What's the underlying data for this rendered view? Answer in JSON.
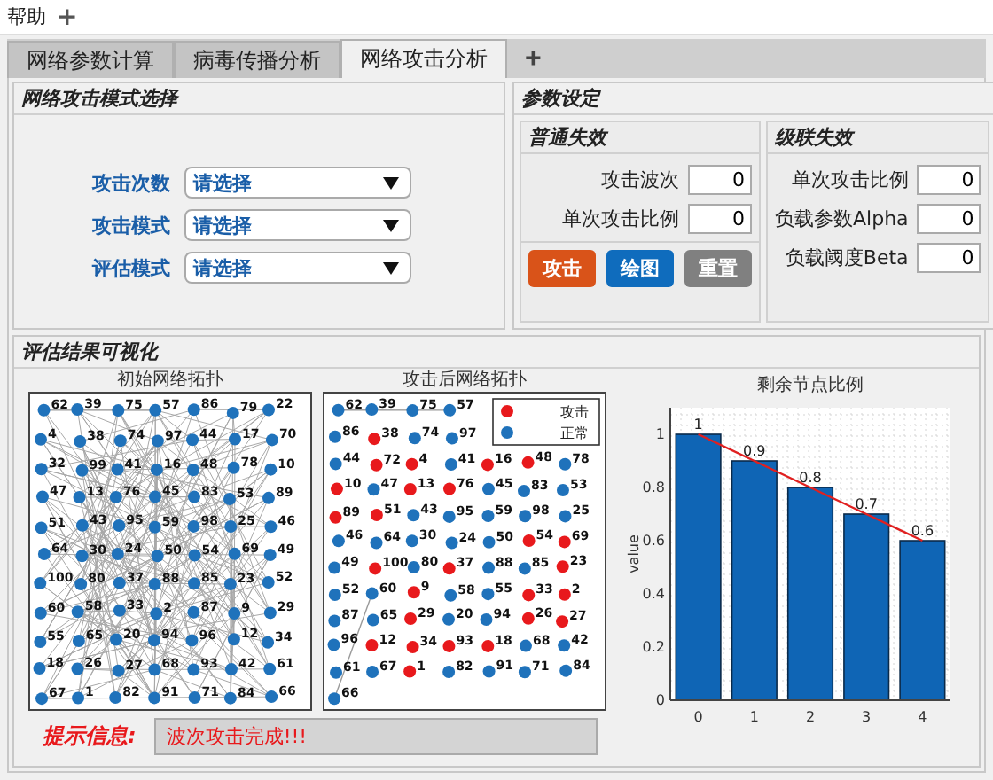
{
  "menu": [
    {
      "label": "帮助"
    },
    {
      "label": "+"
    }
  ],
  "tabs": [
    {
      "label": "网络参数计算",
      "selected": false
    },
    {
      "label": "病毒传播分析",
      "selected": false
    },
    {
      "label": "网络攻击分析",
      "selected": true
    }
  ],
  "add_tab": "+",
  "attack_mode": {
    "title": "网络攻击模式选择",
    "fields": [
      {
        "label": "攻击次数",
        "value": "请选择"
      },
      {
        "label": "攻击模式",
        "value": "请选择"
      },
      {
        "label": "评估模式",
        "value": "请选择"
      }
    ]
  },
  "parameters": {
    "title": "参数设定",
    "normal": {
      "title": "普通失效",
      "fields": [
        {
          "label": "攻击波次",
          "value": "0"
        },
        {
          "label": "单次攻击比例",
          "value": "0"
        }
      ],
      "buttons": [
        {
          "label": "攻击",
          "color": "#d95319"
        },
        {
          "label": "绘图",
          "color": "#0f6cbd"
        },
        {
          "label": "重置",
          "color": "#808080"
        }
      ]
    },
    "cascade": {
      "title": "级联失效",
      "fields": [
        {
          "label": "单次攻击比例",
          "value": "0"
        },
        {
          "label": "负载参数Alpha",
          "value": "0"
        },
        {
          "label": "负载阈度Beta",
          "value": "0"
        }
      ]
    }
  },
  "visualization": {
    "title": "评估结果可视化",
    "initial_graph": {
      "title": "初始网络拓扑",
      "nodes": [
        {
          "label": "62"
        },
        {
          "label": "39"
        },
        {
          "label": "75"
        },
        {
          "label": "57"
        },
        {
          "label": "86"
        },
        {
          "label": "79"
        },
        {
          "label": "22"
        },
        {
          "label": "4"
        },
        {
          "label": "38"
        },
        {
          "label": "74"
        },
        {
          "label": "97"
        },
        {
          "label": "44"
        },
        {
          "label": "17"
        },
        {
          "label": "70"
        },
        {
          "label": "32"
        },
        {
          "label": "99"
        },
        {
          "label": "41"
        },
        {
          "label": "16"
        },
        {
          "label": "48"
        },
        {
          "label": "78"
        },
        {
          "label": "10"
        },
        {
          "label": "47"
        },
        {
          "label": "13"
        },
        {
          "label": "76"
        },
        {
          "label": "45"
        },
        {
          "label": "83"
        },
        {
          "label": "53"
        },
        {
          "label": "89"
        },
        {
          "label": "51"
        },
        {
          "label": "43"
        },
        {
          "label": "95"
        },
        {
          "label": "59"
        },
        {
          "label": "98"
        },
        {
          "label": "25"
        },
        {
          "label": "46"
        },
        {
          "label": "64"
        },
        {
          "label": "30"
        },
        {
          "label": "24"
        },
        {
          "label": "50"
        },
        {
          "label": "54"
        },
        {
          "label": "69"
        },
        {
          "label": "49"
        },
        {
          "label": "100"
        },
        {
          "label": "80"
        },
        {
          "label": "37"
        },
        {
          "label": "88"
        },
        {
          "label": "85"
        },
        {
          "label": "23"
        },
        {
          "label": "52"
        },
        {
          "label": "60"
        },
        {
          "label": "58"
        },
        {
          "label": "33"
        },
        {
          "label": "2"
        },
        {
          "label": "87"
        },
        {
          "label": "9"
        },
        {
          "label": "29"
        },
        {
          "label": "55"
        },
        {
          "label": "65"
        },
        {
          "label": "20"
        },
        {
          "label": "94"
        },
        {
          "label": "96"
        },
        {
          "label": "12"
        },
        {
          "label": "34"
        },
        {
          "label": "18"
        },
        {
          "label": "26"
        },
        {
          "label": "27"
        },
        {
          "label": "68"
        },
        {
          "label": "93"
        },
        {
          "label": "42"
        },
        {
          "label": "61"
        },
        {
          "label": "67"
        },
        {
          "label": "1"
        },
        {
          "label": "82"
        },
        {
          "label": "91"
        },
        {
          "label": "71"
        },
        {
          "label": "84"
        },
        {
          "label": "66"
        }
      ]
    },
    "attacked_graph": {
      "title": "攻击后网络拓扑",
      "legend": [
        {
          "label": "攻击",
          "color": "#e8191c"
        },
        {
          "label": "正常",
          "color": "#1f72bb"
        }
      ],
      "nodes": [
        {
          "label": "62",
          "attacked": false
        },
        {
          "label": "39",
          "attacked": false
        },
        {
          "label": "75",
          "attacked": false
        },
        {
          "label": "57",
          "attacked": false
        },
        {
          "label": "86",
          "attacked": false
        },
        {
          "label": "38",
          "attacked": true
        },
        {
          "label": "74",
          "attacked": false
        },
        {
          "label": "97",
          "attacked": false
        },
        {
          "label": "44",
          "attacked": false
        },
        {
          "label": "72",
          "attacked": true
        },
        {
          "label": "4",
          "attacked": true
        },
        {
          "label": "41",
          "attacked": false
        },
        {
          "label": "16",
          "attacked": true
        },
        {
          "label": "48",
          "attacked": true
        },
        {
          "label": "78",
          "attacked": false
        },
        {
          "label": "10",
          "attacked": true
        },
        {
          "label": "47",
          "attacked": false
        },
        {
          "label": "13",
          "attacked": true
        },
        {
          "label": "76",
          "attacked": true
        },
        {
          "label": "45",
          "attacked": false
        },
        {
          "label": "83",
          "attacked": false
        },
        {
          "label": "53",
          "attacked": false
        },
        {
          "label": "89",
          "attacked": true
        },
        {
          "label": "51",
          "attacked": true
        },
        {
          "label": "43",
          "attacked": false
        },
        {
          "label": "95",
          "attacked": false
        },
        {
          "label": "59",
          "attacked": false
        },
        {
          "label": "98",
          "attacked": false
        },
        {
          "label": "25",
          "attacked": false
        },
        {
          "label": "46",
          "attacked": false
        },
        {
          "label": "64",
          "attacked": false
        },
        {
          "label": "30",
          "attacked": false
        },
        {
          "label": "24",
          "attacked": false
        },
        {
          "label": "50",
          "attacked": false
        },
        {
          "label": "54",
          "attacked": true
        },
        {
          "label": "69",
          "attacked": true
        },
        {
          "label": "49",
          "attacked": false
        },
        {
          "label": "100",
          "attacked": true
        },
        {
          "label": "80",
          "attacked": false
        },
        {
          "label": "37",
          "attacked": true
        },
        {
          "label": "88",
          "attacked": false
        },
        {
          "label": "85",
          "attacked": false
        },
        {
          "label": "23",
          "attacked": true
        },
        {
          "label": "52",
          "attacked": false
        },
        {
          "label": "60",
          "attacked": false
        },
        {
          "label": "9",
          "attacked": true
        },
        {
          "label": "58",
          "attacked": false
        },
        {
          "label": "55",
          "attacked": false
        },
        {
          "label": "33",
          "attacked": true
        },
        {
          "label": "2",
          "attacked": true
        },
        {
          "label": "87",
          "attacked": false
        },
        {
          "label": "65",
          "attacked": false
        },
        {
          "label": "29",
          "attacked": true
        },
        {
          "label": "20",
          "attacked": false
        },
        {
          "label": "94",
          "attacked": false
        },
        {
          "label": "26",
          "attacked": true
        },
        {
          "label": "27",
          "attacked": true
        },
        {
          "label": "96",
          "attacked": false
        },
        {
          "label": "12",
          "attacked": true
        },
        {
          "label": "34",
          "attacked": true
        },
        {
          "label": "93",
          "attacked": true
        },
        {
          "label": "18",
          "attacked": true
        },
        {
          "label": "68",
          "attacked": false
        },
        {
          "label": "42",
          "attacked": false
        },
        {
          "label": "61",
          "attacked": false
        },
        {
          "label": "67",
          "attacked": false
        },
        {
          "label": "1",
          "attacked": true
        },
        {
          "label": "82",
          "attacked": false
        },
        {
          "label": "91",
          "attacked": false
        },
        {
          "label": "71",
          "attacked": false
        },
        {
          "label": "84",
          "attacked": false
        },
        {
          "label": "66",
          "attacked": false
        }
      ]
    },
    "chart_data": {
      "type": "bar",
      "title": "剩余节点比例",
      "ylabel": "value",
      "categories": [
        "0",
        "1",
        "2",
        "3",
        "4"
      ],
      "values": [
        1,
        0.9,
        0.8,
        0.7,
        0.6
      ],
      "ylim": [
        0,
        1.1
      ],
      "yticks": [
        0,
        0.2,
        0.4,
        0.6,
        0.8,
        1
      ],
      "data_labels": true,
      "grid": true
    }
  },
  "message": {
    "label": "提示信息:",
    "text": "波次攻击完成!!!"
  }
}
